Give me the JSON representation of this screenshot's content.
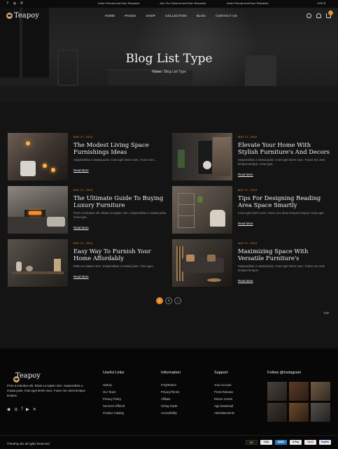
{
  "topbar": {
    "announcements": [
      "Invite Friends And Earn Rewards!",
      "Join Our Scheme And Earn Rewards!",
      "Invite Friends And Earn Rewards!"
    ],
    "currency": "USD $"
  },
  "header": {
    "brand": "Teapoy",
    "menu": [
      "HOME",
      "PAGES",
      "SHOP",
      "COLLECTION",
      "BLOG",
      "CONTACT US"
    ],
    "cart_count": "0"
  },
  "hero": {
    "title": "Blog List Type",
    "breadcrumb_home": "Home",
    "breadcrumb_current": "Blog List Type"
  },
  "posts": [
    {
      "date": "MAY 27, 2024",
      "title": "The Modest Living Space Furnishings Ideas",
      "excerpt": "Suspendisse a massa justo. Cras eget lorem nunc. Fusce nec ...",
      "more": "Read More"
    },
    {
      "date": "MAY 27, 2024",
      "title": "Elevate Your Home With Stylish Furniture's And Decors",
      "excerpt": "Suspendisse a massa justo. Cras eget lorem nunc. Fusce nec ame tempus tempus. Cras eget...",
      "more": "Read More"
    },
    {
      "date": "MAY 27, 2024",
      "title": "The Ultimate Guide To Buying Luxury Furniture",
      "excerpt": "Proin a interdum elit. Etiam eu sapien sem. Suspendisse a massa justo. Cras eget...",
      "more": "Read More"
    },
    {
      "date": "MAY 27, 2024",
      "title": "Tips For Designing Reading Area Space Smartly",
      "excerpt": "Cras eget lorem nunc. Fusce nec amet tempus tempus. Cras eget...",
      "more": "Read More"
    },
    {
      "date": "MAY 27, 2024",
      "title": "Easy Way To Furnish Your Home Affordably",
      "excerpt": "Etiam eu sapien sem. Suspendisse a massa justo. Cras eget...",
      "more": "Read More"
    },
    {
      "date": "MAY 27, 2024",
      "title": "Maximizing Space With Versatile Furniture's",
      "excerpt": "Suspendisse a massa justo. Cras eget lorem nunc. Fusce nec ame tempus tempus.",
      "more": "Read More"
    }
  ],
  "pagination": {
    "pages": [
      "1",
      "2",
      "→"
    ],
    "active": "1"
  },
  "back_to_top": "TOP",
  "footer": {
    "brand": "Teapoy",
    "description": "Proin a interdum elit. Etiam eu sapien sem. Suspendisse a massa justo. Cras eget lorem nunc. Fusce nec amet tempus tempus.",
    "columns": [
      {
        "title": "Useful Links",
        "links": [
          "History",
          "Our Team",
          "Privacy Policy",
          "Services Offered",
          "Product Catalog"
        ]
      },
      {
        "title": "Information",
        "links": [
          "FAQ/Return",
          "Privacy/Terms",
          "Affiliate",
          "Sizing Guide",
          "Accessibility"
        ]
      },
      {
        "title": "Support",
        "links": [
          "Your Account",
          "Press Release",
          "Return Centre",
          "App Download",
          "Advertisements"
        ]
      }
    ],
    "instagram_title": "Follow @Instagram",
    "copyright": "©TeaPoy site all rights Reserved",
    "payments": [
      "MC",
      "VISA",
      "AMEX",
      "G Pay",
      "Skrill",
      "PayPal"
    ]
  },
  "colors": {
    "accent": "#e28b2a",
    "background": "#141414",
    "footer": "#070707"
  }
}
